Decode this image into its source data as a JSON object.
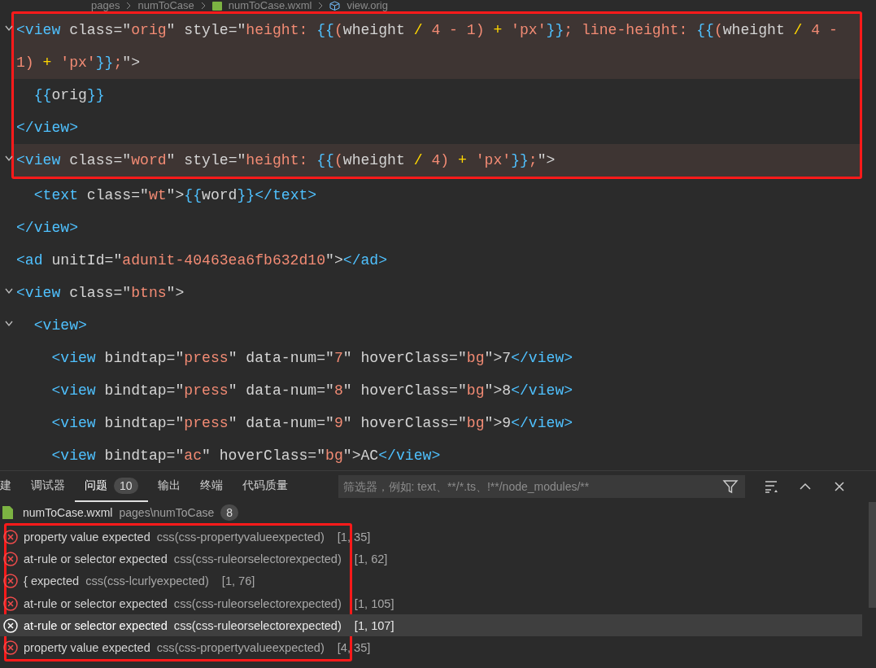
{
  "breadcrumb": {
    "items": [
      {
        "label": "pages",
        "kind": "folder"
      },
      {
        "label": "numToCase",
        "kind": "folder"
      },
      {
        "label": "numToCase.wxml",
        "kind": "file"
      },
      {
        "label": "view.orig",
        "kind": "symbol"
      }
    ]
  },
  "editor": {
    "annotated_rows": [
      {
        "fold": true,
        "highlighted": true,
        "segments": [
          {
            "kind": "tag",
            "t": "<view"
          },
          {
            "kind": "attr",
            "t": " class"
          },
          {
            "kind": "punct",
            "t": "=\""
          },
          {
            "kind": "str",
            "t": "orig"
          },
          {
            "kind": "punct",
            "t": "\""
          },
          {
            "kind": "attr",
            "t": " style"
          },
          {
            "kind": "punct",
            "t": "=\""
          },
          {
            "kind": "str",
            "t": "height: "
          },
          {
            "kind": "brace",
            "t": "{{"
          },
          {
            "kind": "str",
            "t": "("
          },
          {
            "kind": "attr",
            "t": "wheight "
          },
          {
            "kind": "op",
            "t": "/"
          },
          {
            "kind": "str",
            "t": " 4 - 1) "
          },
          {
            "kind": "op",
            "t": "+"
          },
          {
            "kind": "str",
            "t": " 'px'"
          },
          {
            "kind": "brace",
            "t": "}}"
          },
          {
            "kind": "str",
            "t": "; line-height: "
          },
          {
            "kind": "brace",
            "t": "{{"
          },
          {
            "kind": "str",
            "t": "("
          },
          {
            "kind": "attr",
            "t": "wheight "
          },
          {
            "kind": "op",
            "t": "/"
          },
          {
            "kind": "str",
            "t": " 4 -"
          }
        ]
      },
      {
        "fold": false,
        "highlighted": true,
        "segments": [
          {
            "kind": "str",
            "t": "1) "
          },
          {
            "kind": "op",
            "t": "+"
          },
          {
            "kind": "str",
            "t": " 'px'"
          },
          {
            "kind": "brace",
            "t": "}}"
          },
          {
            "kind": "str",
            "t": ";"
          },
          {
            "kind": "punct",
            "t": "\">"
          }
        ]
      },
      {
        "fold": false,
        "highlighted": false,
        "segments": [
          {
            "kind": "brace",
            "t": "  {{"
          },
          {
            "kind": "attr",
            "t": "orig"
          },
          {
            "kind": "brace",
            "t": "}}"
          }
        ]
      },
      {
        "fold": false,
        "highlighted": false,
        "segments": [
          {
            "kind": "tag",
            "t": "</view>"
          }
        ]
      },
      {
        "fold": true,
        "highlighted": true,
        "segments": [
          {
            "kind": "tag",
            "t": "<view"
          },
          {
            "kind": "attr",
            "t": " class"
          },
          {
            "kind": "punct",
            "t": "=\""
          },
          {
            "kind": "str",
            "t": "word"
          },
          {
            "kind": "punct",
            "t": "\""
          },
          {
            "kind": "attr",
            "t": " style"
          },
          {
            "kind": "punct",
            "t": "=\""
          },
          {
            "kind": "str",
            "t": "height: "
          },
          {
            "kind": "brace",
            "t": "{{"
          },
          {
            "kind": "str",
            "t": "("
          },
          {
            "kind": "attr",
            "t": "wheight "
          },
          {
            "kind": "op",
            "t": "/"
          },
          {
            "kind": "str",
            "t": " 4) "
          },
          {
            "kind": "op",
            "t": "+"
          },
          {
            "kind": "str",
            "t": " 'px'"
          },
          {
            "kind": "brace",
            "t": "}}"
          },
          {
            "kind": "str",
            "t": ";"
          },
          {
            "kind": "punct",
            "t": "\">"
          }
        ]
      }
    ],
    "rows": [
      {
        "fold": false,
        "highlighted": false,
        "segments": [
          {
            "kind": "tag",
            "t": "  <text"
          },
          {
            "kind": "attr",
            "t": " class"
          },
          {
            "kind": "punct",
            "t": "=\""
          },
          {
            "kind": "str",
            "t": "wt"
          },
          {
            "kind": "punct",
            "t": "\">"
          },
          {
            "kind": "brace",
            "t": "{{"
          },
          {
            "kind": "attr",
            "t": "word"
          },
          {
            "kind": "brace",
            "t": "}}"
          },
          {
            "kind": "tag",
            "t": "</text>"
          }
        ]
      },
      {
        "fold": false,
        "highlighted": false,
        "segments": [
          {
            "kind": "tag",
            "t": "</view>"
          }
        ]
      },
      {
        "fold": false,
        "highlighted": false,
        "segments": [
          {
            "kind": "tag",
            "t": "<ad"
          },
          {
            "kind": "attr",
            "t": " unitId"
          },
          {
            "kind": "punct",
            "t": "=\""
          },
          {
            "kind": "str",
            "t": "adunit-40463ea6fb632d10"
          },
          {
            "kind": "punct",
            "t": "\">"
          },
          {
            "kind": "tag",
            "t": "</ad>"
          }
        ]
      },
      {
        "fold": true,
        "highlighted": false,
        "segments": [
          {
            "kind": "tag",
            "t": "<view"
          },
          {
            "kind": "attr",
            "t": " class"
          },
          {
            "kind": "punct",
            "t": "=\""
          },
          {
            "kind": "str",
            "t": "btns"
          },
          {
            "kind": "punct",
            "t": "\">"
          }
        ]
      },
      {
        "fold": true,
        "highlighted": false,
        "segments": [
          {
            "kind": "tag",
            "t": "  <view>"
          }
        ]
      },
      {
        "fold": false,
        "highlighted": false,
        "segments": [
          {
            "kind": "tag",
            "t": "    <view"
          },
          {
            "kind": "attr",
            "t": " bindtap"
          },
          {
            "kind": "punct",
            "t": "=\""
          },
          {
            "kind": "str",
            "t": "press"
          },
          {
            "kind": "punct",
            "t": "\""
          },
          {
            "kind": "attr",
            "t": " data-num"
          },
          {
            "kind": "punct",
            "t": "=\""
          },
          {
            "kind": "str",
            "t": "7"
          },
          {
            "kind": "punct",
            "t": "\""
          },
          {
            "kind": "attr",
            "t": " hoverClass"
          },
          {
            "kind": "punct",
            "t": "=\""
          },
          {
            "kind": "str",
            "t": "bg"
          },
          {
            "kind": "punct",
            "t": "\">"
          },
          {
            "kind": "attr",
            "t": "7"
          },
          {
            "kind": "tag",
            "t": "</view>"
          }
        ]
      },
      {
        "fold": false,
        "highlighted": false,
        "segments": [
          {
            "kind": "tag",
            "t": "    <view"
          },
          {
            "kind": "attr",
            "t": " bindtap"
          },
          {
            "kind": "punct",
            "t": "=\""
          },
          {
            "kind": "str",
            "t": "press"
          },
          {
            "kind": "punct",
            "t": "\""
          },
          {
            "kind": "attr",
            "t": " data-num"
          },
          {
            "kind": "punct",
            "t": "=\""
          },
          {
            "kind": "str",
            "t": "8"
          },
          {
            "kind": "punct",
            "t": "\""
          },
          {
            "kind": "attr",
            "t": " hoverClass"
          },
          {
            "kind": "punct",
            "t": "=\""
          },
          {
            "kind": "str",
            "t": "bg"
          },
          {
            "kind": "punct",
            "t": "\">"
          },
          {
            "kind": "attr",
            "t": "8"
          },
          {
            "kind": "tag",
            "t": "</view>"
          }
        ]
      },
      {
        "fold": false,
        "highlighted": false,
        "segments": [
          {
            "kind": "tag",
            "t": "    <view"
          },
          {
            "kind": "attr",
            "t": " bindtap"
          },
          {
            "kind": "punct",
            "t": "=\""
          },
          {
            "kind": "str",
            "t": "press"
          },
          {
            "kind": "punct",
            "t": "\""
          },
          {
            "kind": "attr",
            "t": " data-num"
          },
          {
            "kind": "punct",
            "t": "=\""
          },
          {
            "kind": "str",
            "t": "9"
          },
          {
            "kind": "punct",
            "t": "\""
          },
          {
            "kind": "attr",
            "t": " hoverClass"
          },
          {
            "kind": "punct",
            "t": "=\""
          },
          {
            "kind": "str",
            "t": "bg"
          },
          {
            "kind": "punct",
            "t": "\">"
          },
          {
            "kind": "attr",
            "t": "9"
          },
          {
            "kind": "tag",
            "t": "</view>"
          }
        ]
      },
      {
        "fold": false,
        "highlighted": false,
        "segments": [
          {
            "kind": "tag",
            "t": "    <view"
          },
          {
            "kind": "attr",
            "t": " bindtap"
          },
          {
            "kind": "punct",
            "t": "=\""
          },
          {
            "kind": "str",
            "t": "ac"
          },
          {
            "kind": "punct",
            "t": "\""
          },
          {
            "kind": "attr",
            "t": " hoverClass"
          },
          {
            "kind": "punct",
            "t": "=\""
          },
          {
            "kind": "str",
            "t": "bg"
          },
          {
            "kind": "punct",
            "t": "\">"
          },
          {
            "kind": "attr",
            "t": "AC"
          },
          {
            "kind": "tag",
            "t": "</view>"
          }
        ]
      }
    ]
  },
  "panel": {
    "tabs": [
      {
        "label": "建",
        "selected": false
      },
      {
        "label": "调试器",
        "selected": false
      },
      {
        "label": "问题",
        "selected": true,
        "count": "10"
      },
      {
        "label": "输出",
        "selected": false
      },
      {
        "label": "终端",
        "selected": false
      },
      {
        "label": "代码质量",
        "selected": false
      }
    ],
    "filter": {
      "placeholder": "筛选器，例如: text、**/*.ts、!**/node_modules/**"
    },
    "file": {
      "name": "numToCase.wxml",
      "path": "pages\\numToCase",
      "count": "8"
    },
    "annotated_problems": [
      {
        "message": "property value expected",
        "source": "css(css-propertyvalueexpected)",
        "position": "[1, 35]",
        "selected": false
      },
      {
        "message": "at-rule or selector expected",
        "source": "css(css-ruleorselectorexpected)",
        "position": "[1, 62]",
        "selected": false
      },
      {
        "message": "{ expected",
        "source": "css(css-lcurlyexpected)",
        "position": "[1, 76]",
        "selected": false
      },
      {
        "message": "at-rule or selector expected",
        "source": "css(css-ruleorselectorexpected)",
        "position": "[1, 105]",
        "selected": false
      },
      {
        "message": "at-rule or selector expected",
        "source": "css(css-ruleorselectorexpected)",
        "position": "[1, 107]",
        "selected": true
      },
      {
        "message": "property value expected",
        "source": "css(css-propertyvalueexpected)",
        "position": "[4, 35]",
        "selected": false
      }
    ]
  }
}
